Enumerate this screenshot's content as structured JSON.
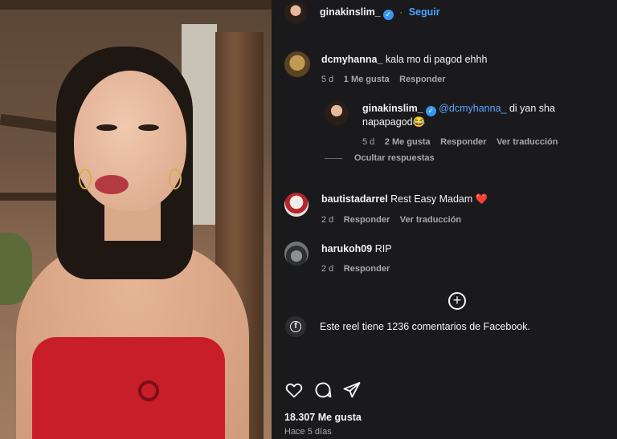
{
  "header": {
    "username": "ginakinslim_",
    "verified_mark": "✓",
    "separator": "·",
    "follow_label": "Seguir"
  },
  "comments": [
    {
      "username": "dcmyhanna_",
      "text": "kala mo di pagod ehhh",
      "age": "5 d",
      "likes": "1 Me gusta",
      "reply_label": "Responder"
    },
    {
      "username": "ginakinslim_",
      "verified_mark": "✓",
      "mention": "@dcmyhanna_",
      "text_line1": " di yan sha",
      "text_line2": "napapagod😂",
      "age": "5 d",
      "likes": "2 Me gusta",
      "reply_label": "Responder",
      "translate_label": "Ver traducción"
    },
    {
      "username": "bautistadarrel",
      "text": "Rest Easy Madam ❤️",
      "age": "2 d",
      "reply_label": "Responder",
      "translate_label": "Ver traducción"
    },
    {
      "username": "harukoh09",
      "text": "RIP",
      "age": "2 d",
      "reply_label": "Responder"
    }
  ],
  "hide_replies_label": "Ocultar respuestas",
  "load_more_icon": "plus-circle-icon",
  "facebook_notice": "Este reel tiene 1236 comentarios de Facebook.",
  "facebook_icon_glyph": "f",
  "likes_count": "18.307 Me gusta",
  "posted_ago": "Hace 5 días",
  "icons": {
    "like": "heart-icon",
    "comment": "comment-icon",
    "share": "send-icon"
  },
  "colors": {
    "panel_bg": "#1a1a1d",
    "link_blue": "#4aa3ff",
    "verified_blue": "#3897f0"
  }
}
